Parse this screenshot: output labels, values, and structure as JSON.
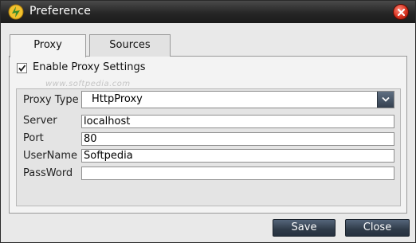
{
  "window": {
    "title": "Preference"
  },
  "tabs": [
    {
      "label": "Proxy",
      "active": true
    },
    {
      "label": "Sources",
      "active": false
    }
  ],
  "proxy": {
    "enable_label": "Enable Proxy Settings",
    "enabled": true,
    "watermark": "www.softpedia.com",
    "fields": {
      "type_label": "Proxy Type",
      "type_value": "HttpProxy",
      "server_label": "Server",
      "server_value": "localhost",
      "port_label": "Port",
      "port_value": "80",
      "username_label": "UserName",
      "username_value": "Softpedia",
      "password_label": "PassWord",
      "password_value": ""
    }
  },
  "buttons": {
    "save": "Save",
    "close": "Close"
  },
  "colors": {
    "titlebar": "#262626",
    "button": "#2f3b49",
    "close_icon": "#d8321f"
  },
  "icons": {
    "app": "app-logo-icon",
    "close": "close-icon",
    "check": "check-icon",
    "dropdown": "chevron-down-icon"
  }
}
